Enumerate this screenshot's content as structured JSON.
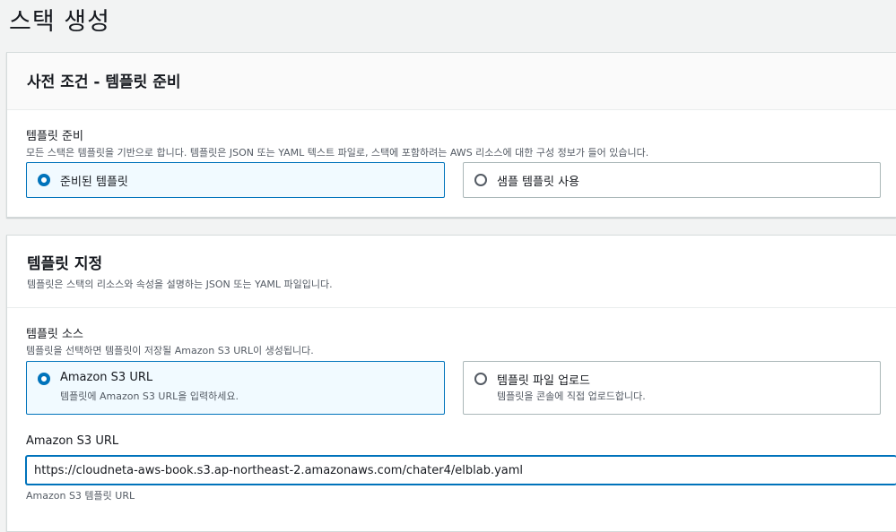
{
  "page": {
    "title": "스택 생성"
  },
  "prerequisite": {
    "title": "사전 조건 - 템플릿 준비",
    "field_label": "템플릿 준비",
    "field_desc": "모든 스택은 템플릿을 기반으로 합니다. 템플릿은 JSON 또는 YAML 텍스트 파일로, 스택에 포함하려는 AWS 리소스에 대한 구성 정보가 들어 있습니다.",
    "options": [
      {
        "label": "준비된 템플릿",
        "selected": true
      },
      {
        "label": "샘플 템플릿 사용",
        "selected": false
      }
    ]
  },
  "specify": {
    "title": "템플릿 지정",
    "desc": "템플릿은 스택의 리소스와 속성을 설명하는 JSON 또는 YAML 파일입니다.",
    "source_label": "템플릿 소스",
    "source_desc": "템플릿을 선택하면 템플릿이 저장될 Amazon S3 URL이 생성됩니다.",
    "options": [
      {
        "label": "Amazon S3 URL",
        "desc": "템플릿에 Amazon S3 URL을 입력하세요.",
        "selected": true
      },
      {
        "label": "템플릿 파일 업로드",
        "desc": "템플릿을 콘솔에 직접 업로드합니다.",
        "selected": false
      }
    ],
    "url_label": "Amazon S3 URL",
    "url_value": "https://cloudneta-aws-book.s3.ap-northeast-2.amazonaws.com/chater4/elblab.yaml",
    "url_hint": "Amazon S3 템플릿 URL"
  },
  "colors": {
    "accent": "#0073bb",
    "selected_bg": "#f1faff",
    "page_bg": "#f2f3f3"
  }
}
